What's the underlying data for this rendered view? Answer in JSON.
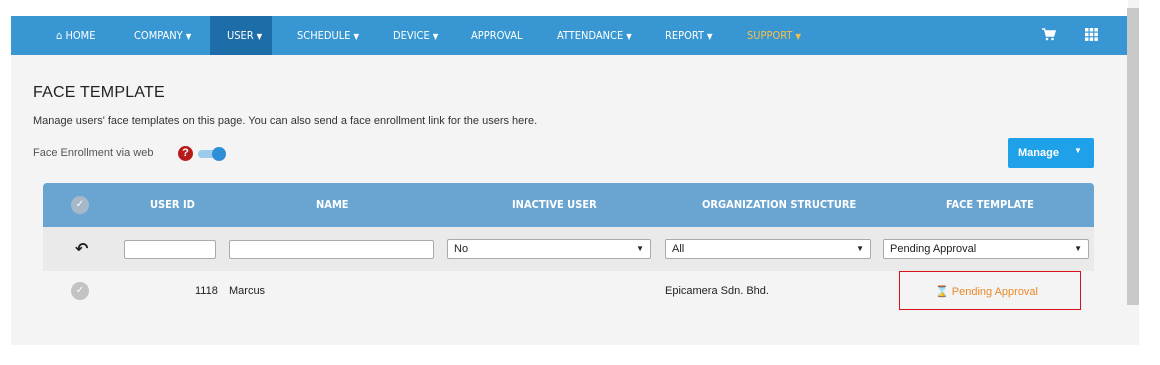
{
  "nav": {
    "home": "HOME",
    "company": "COMPANY",
    "user": "USER",
    "schedule": "SCHEDULE",
    "device": "DEVICE",
    "approval": "APPROVAL",
    "attendance": "ATTENDANCE",
    "report": "REPORT",
    "support": "SUPPORT",
    "active_color": "#1d6ea8",
    "bar_color": "#3897d3"
  },
  "page": {
    "title": "FACE TEMPLATE",
    "description": "Manage users' face templates on this page. You can also send a face enrollment link for the users here.",
    "face_enrollment_label": "Face Enrollment via web",
    "face_enrollment_enabled": true,
    "manage_label": "Manage"
  },
  "table": {
    "columns": [
      "USER ID",
      "NAME",
      "INACTIVE USER",
      "ORGANIZATION STRUCTURE",
      "FACE TEMPLATE"
    ],
    "filters": {
      "user_id": "",
      "name": "",
      "inactive_user": "No",
      "organization_structure": "All",
      "face_template": "Pending Approval"
    },
    "rows": [
      {
        "user_id": "1118",
        "name": "Marcus",
        "inactive_user": "",
        "organization_structure": "Epicamera Sdn. Bhd.",
        "face_template": "Pending Approval"
      }
    ]
  },
  "icons": {
    "home": "home-icon",
    "cart": "cart-icon",
    "apps": "grid-icon",
    "help": "question-icon",
    "reset": "undo-icon",
    "pending": "hourglass-icon"
  }
}
